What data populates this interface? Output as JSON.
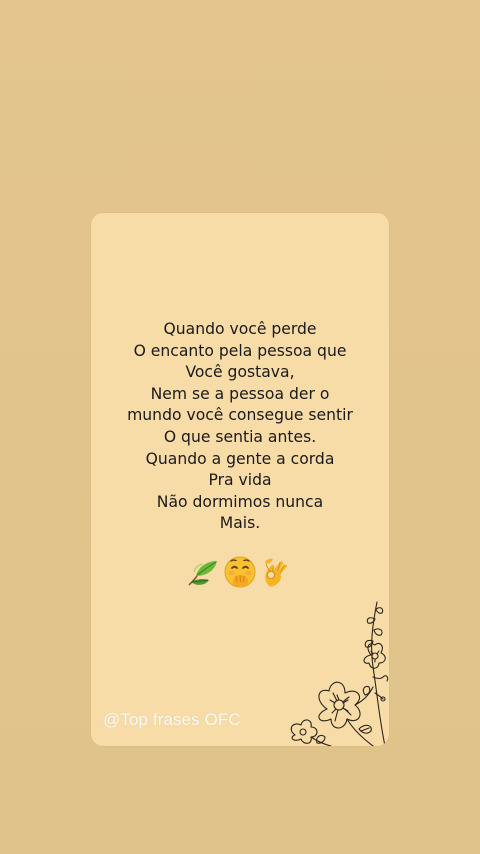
{
  "post": {
    "quote_lines": [
      "Quando você perde",
      "O encanto pela pessoa que",
      "Você gostava,",
      "Nem se a pessoa der o",
      "mundo você consegue sentir",
      "O que sentia antes.",
      "Quando a gente a corda",
      "Pra vida",
      "Não dormimos nunca",
      "Mais."
    ],
    "emojis": [
      "leaf-fluttering-icon",
      "hand-over-mouth-face-icon",
      "ok-hand-icon"
    ],
    "watermark": "@Top frases OFC"
  },
  "colors": {
    "background": "#e2c48b",
    "card": "#f8dca8",
    "text": "#1a1a1a",
    "watermark": "#ffffff",
    "flower_line": "#2b241b"
  }
}
